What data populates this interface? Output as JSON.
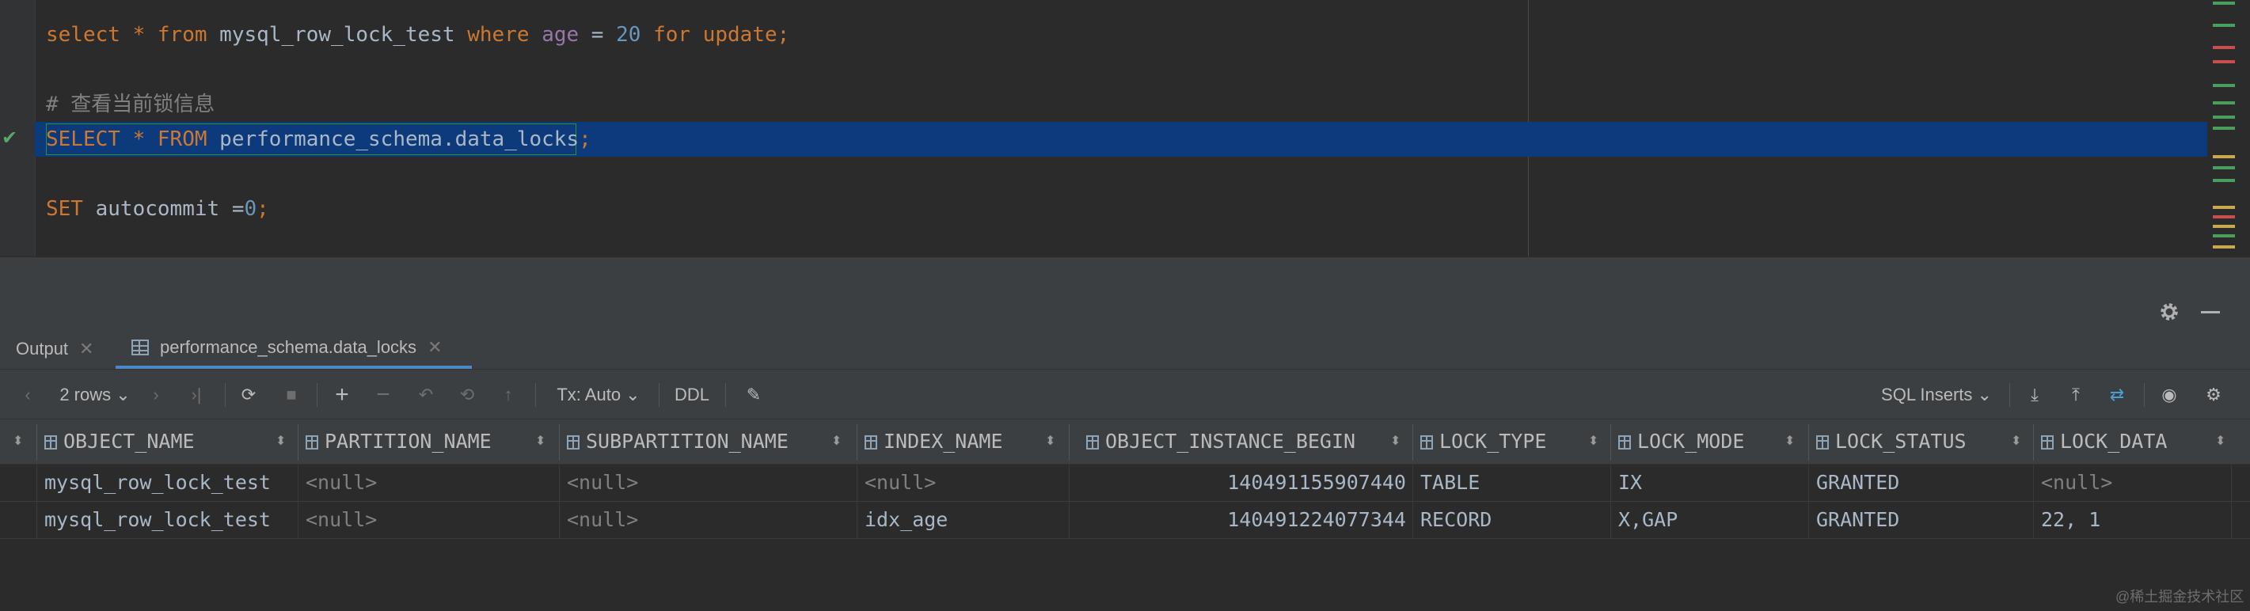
{
  "editor": {
    "line1": {
      "kw1": "select",
      "sp1": " ",
      "star": "*",
      "sp2": " ",
      "kw2": "from",
      "sp3": " ",
      "table": "mysql_row_lock_test",
      "sp4": " ",
      "kw3": "where",
      "sp5": " ",
      "field": "age",
      "eq": " = ",
      "num": "20",
      "sp6": " ",
      "kw4": "for update",
      "semi": ";"
    },
    "line2": {
      "comment": "# 查看当前锁信息"
    },
    "line3": {
      "kw1": "SELECT",
      "sp1": " ",
      "star": "*",
      "sp2": " ",
      "kw2": "FROM",
      "sp3": " ",
      "target": "performance_schema.data_locks",
      "semi": ";"
    },
    "line4": {
      "kw1": "SET",
      "ident": " autocommit ",
      "eq": "=",
      "num": "0",
      "semi": ";"
    }
  },
  "tabs": [
    {
      "label": "Output",
      "close": "✕"
    },
    {
      "label": "performance_schema.data_locks",
      "close": "✕"
    }
  ],
  "toolbar": {
    "rows": "2 rows ⌄",
    "tx": "Tx: Auto ⌄",
    "ddl": "DDL",
    "sql_inserts": "SQL Inserts ⌄"
  },
  "grid": {
    "columns": [
      "OBJECT_NAME",
      "PARTITION_NAME",
      "SUBPARTITION_NAME",
      "INDEX_NAME",
      "OBJECT_INSTANCE_BEGIN",
      "LOCK_TYPE",
      "LOCK_MODE",
      "LOCK_STATUS",
      "LOCK_DATA"
    ],
    "rows": [
      [
        "mysql_row_lock_test",
        "<null>",
        "<null>",
        "<null>",
        "140491155907440",
        "TABLE",
        "IX",
        "GRANTED",
        "<null>"
      ],
      [
        "mysql_row_lock_test",
        "<null>",
        "<null>",
        "idx_age",
        "140491224077344",
        "RECORD",
        "X,GAP",
        "GRANTED",
        "22, 1"
      ]
    ]
  },
  "watermark": "@稀土掘金技术社区",
  "colors": {
    "keyword": "#cc7832",
    "identifier": "#a9b7c6",
    "number": "#6897bb",
    "field": "#9876aa",
    "comment": "#808080",
    "selection": "#0d3a7a"
  }
}
